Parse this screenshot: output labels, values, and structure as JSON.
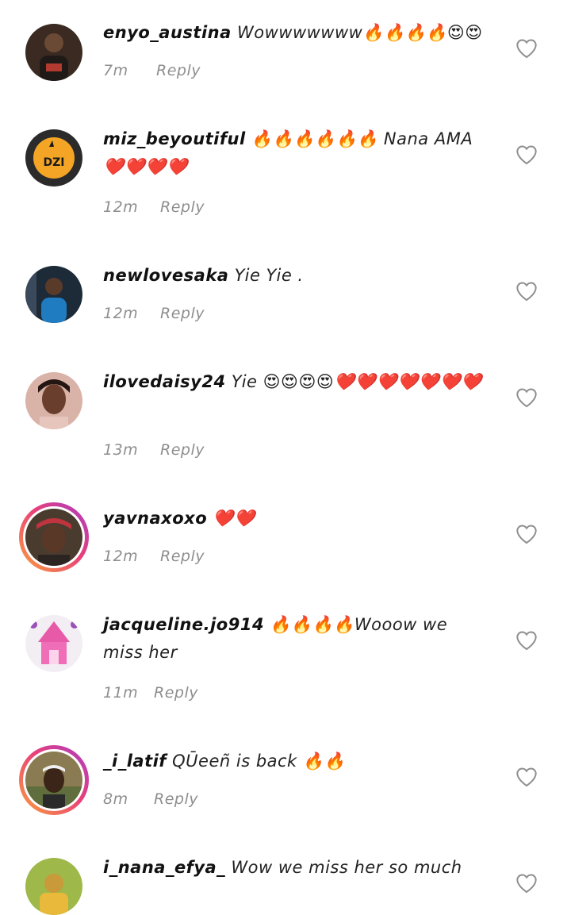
{
  "comments": [
    {
      "username": "enyo_austina",
      "text": "Wowwwwwww🔥🔥🔥🔥😍😍",
      "time": "7m",
      "reply_label": "Reply",
      "avatar_style": "plain"
    },
    {
      "username": "miz_beyoutiful",
      "text": "🔥🔥🔥🔥🔥🔥 Nana AMA ❤️❤️❤️❤️",
      "time": "12m",
      "reply_label": "Reply",
      "avatar_style": "plain"
    },
    {
      "username": "newlovesaka",
      "text": "Yie Yie .",
      "time": "12m",
      "reply_label": "Reply",
      "avatar_style": "plain"
    },
    {
      "username": "ilovedaisy24",
      "text": "Yie 😍😍😍😍❤️❤️❤️❤️❤️❤️❤️",
      "time": "13m",
      "reply_label": "Reply",
      "avatar_style": "plain"
    },
    {
      "username": "yavnaxoxo",
      "text": "❤️❤️",
      "time": "12m",
      "reply_label": "Reply",
      "avatar_style": "story"
    },
    {
      "username": "jacqueline.jo914",
      "text": "🔥🔥🔥🔥Wooow we miss her",
      "time": "11m",
      "reply_label": "Reply",
      "avatar_style": "plain"
    },
    {
      "username": "_i_latif",
      "text": "QŪeeñ is back 🔥🔥",
      "time": "8m",
      "reply_label": "Reply",
      "avatar_style": "story"
    },
    {
      "username": "i_nana_efya_",
      "text": "Wow we miss her so much",
      "time": "",
      "reply_label": "",
      "avatar_style": "plain"
    }
  ]
}
